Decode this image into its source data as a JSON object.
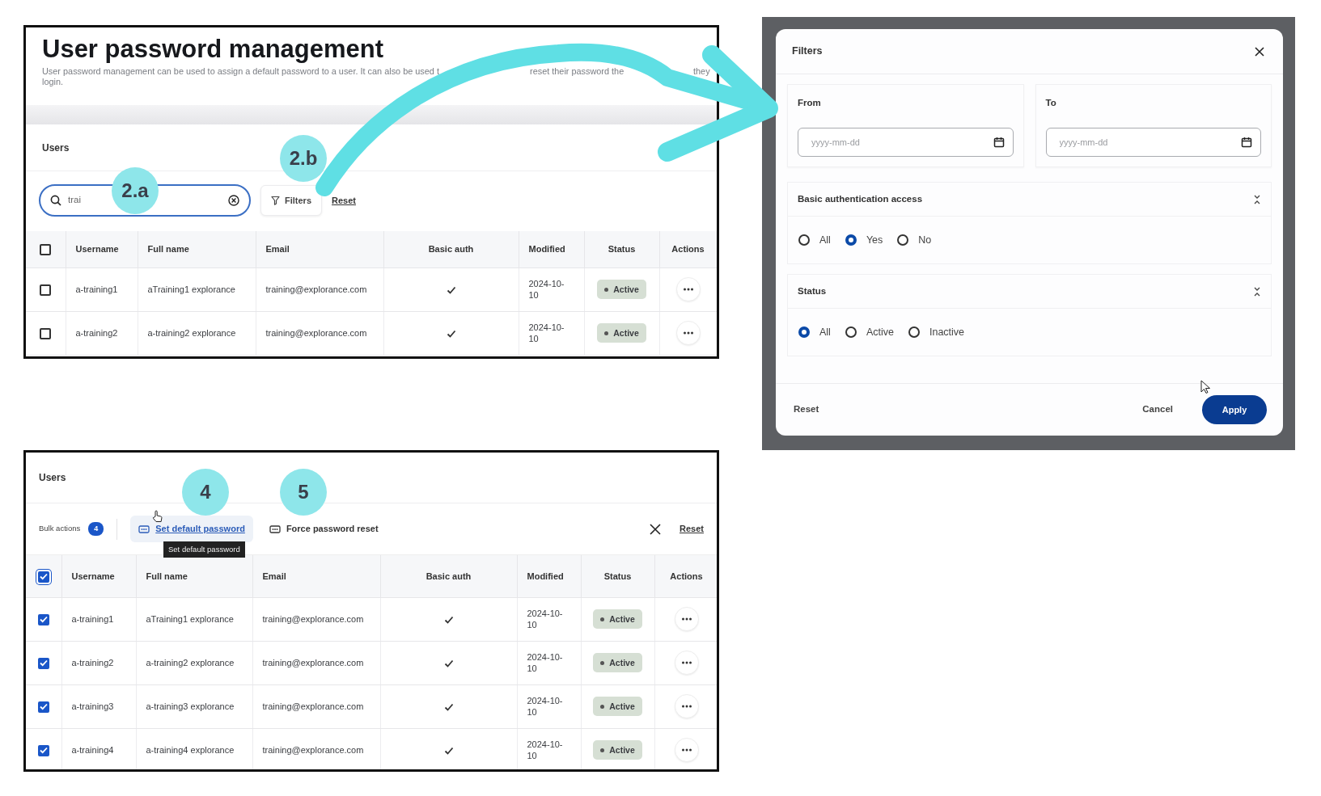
{
  "overview": {
    "title": "User password management",
    "description_fragments": [
      "User password management can be used to assign a default password to a user. It can also be used t",
      "reset their password the",
      "they",
      "login."
    ],
    "section_title": "Users",
    "search": {
      "value": "trai"
    },
    "filters_button": "Filters",
    "reset_link": "Reset",
    "callouts": [
      {
        "label": "2.a"
      },
      {
        "label": "2.b"
      }
    ],
    "table": {
      "all_selected": false,
      "columns": [
        "Username",
        "Full name",
        "Email",
        "Basic auth",
        "Modified",
        "Status",
        "Actions"
      ],
      "rows": [
        {
          "selected": false,
          "username": "a-training1",
          "full_name": "aTraining1 explorance",
          "email": "training@explorance.com",
          "basic_auth": true,
          "modified": "2024-10-10",
          "status": "Active"
        },
        {
          "selected": false,
          "username": "a-training2",
          "full_name": "a-training2 explorance",
          "email": "training@explorance.com",
          "basic_auth": true,
          "modified": "2024-10-10",
          "status": "Active"
        }
      ]
    }
  },
  "filters_dialog": {
    "title": "Filters",
    "date_fields": [
      {
        "label": "From",
        "placeholder": "yyyy-mm-dd"
      },
      {
        "label": "To",
        "placeholder": "yyyy-mm-dd"
      }
    ],
    "groups": [
      {
        "title": "Basic authentication access",
        "options": [
          {
            "label": "All",
            "selected": false
          },
          {
            "label": "Yes",
            "selected": true
          },
          {
            "label": "No",
            "selected": false
          }
        ]
      },
      {
        "title": "Status",
        "options": [
          {
            "label": "All",
            "selected": true
          },
          {
            "label": "Active",
            "selected": false
          },
          {
            "label": "Inactive",
            "selected": false
          }
        ]
      }
    ],
    "reset_button": "Reset",
    "cancel_button": "Cancel",
    "apply_button": "Apply"
  },
  "bulk_view": {
    "section_title": "Users",
    "bulk_actions_label": "Bulk actions",
    "selected_count": "4",
    "actions": [
      {
        "label": "Set default password",
        "hovered": true
      },
      {
        "label": "Force password reset",
        "hovered": false
      }
    ],
    "tooltip": "Set default password",
    "reset_link": "Reset",
    "callouts": [
      {
        "label": "4"
      },
      {
        "label": "5"
      }
    ],
    "table": {
      "all_selected": true,
      "columns": [
        "Username",
        "Full name",
        "Email",
        "Basic auth",
        "Modified",
        "Status",
        "Actions"
      ],
      "rows": [
        {
          "selected": true,
          "username": "a-training1",
          "full_name": "aTraining1 explorance",
          "email": "training@explorance.com",
          "basic_auth": true,
          "modified": "2024-10-10",
          "status": "Active"
        },
        {
          "selected": true,
          "username": "a-training2",
          "full_name": "a-training2 explorance",
          "email": "training@explorance.com",
          "basic_auth": true,
          "modified": "2024-10-10",
          "status": "Active"
        },
        {
          "selected": true,
          "username": "a-training3",
          "full_name": "a-training3 explorance",
          "email": "training@explorance.com",
          "basic_auth": true,
          "modified": "2024-10-10",
          "status": "Active"
        },
        {
          "selected": true,
          "username": "a-training4",
          "full_name": "a-training4 explorance",
          "email": "training@explorance.com",
          "basic_auth": true,
          "modified": "2024-10-10",
          "status": "Active"
        }
      ]
    }
  }
}
